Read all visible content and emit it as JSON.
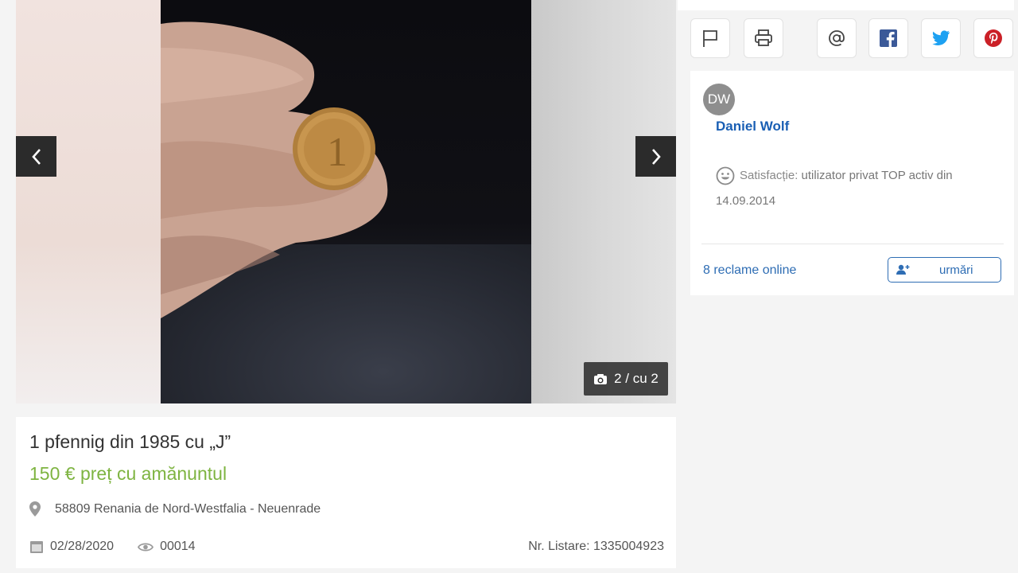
{
  "gallery": {
    "counter": "2 / cu 2",
    "prev_icon": "chevron-left-icon",
    "next_icon": "chevron-right-icon"
  },
  "listing": {
    "title": "1 pfennig din 1985 cu „J”",
    "price": "150 € preț cu amănuntul",
    "location": "58809 Renania de Nord-Westfalia - Neuenrade",
    "date": "02/28/2020",
    "views": "00014",
    "listing_number": "Nr. Listare: 1335004923"
  },
  "share": {
    "buttons": [
      "flag-icon",
      "print-icon",
      "email-at-icon",
      "facebook-icon",
      "twitter-icon",
      "pinterest-icon"
    ]
  },
  "seller": {
    "initials": "DW",
    "name": "Daniel Wolf",
    "satisfaction_label": "Satisfacție:",
    "satisfaction_value_line1": "utilizator privat TOP activ din",
    "satisfaction_value_line2": "14.09.2014",
    "ads_link": "8 reclame online",
    "follow_label": "urmări"
  },
  "colors": {
    "price_green": "#7eb441",
    "link_blue": "#2e6db4",
    "facebook": "#3b5998",
    "twitter": "#1da1f2",
    "pinterest": "#cb2027"
  }
}
